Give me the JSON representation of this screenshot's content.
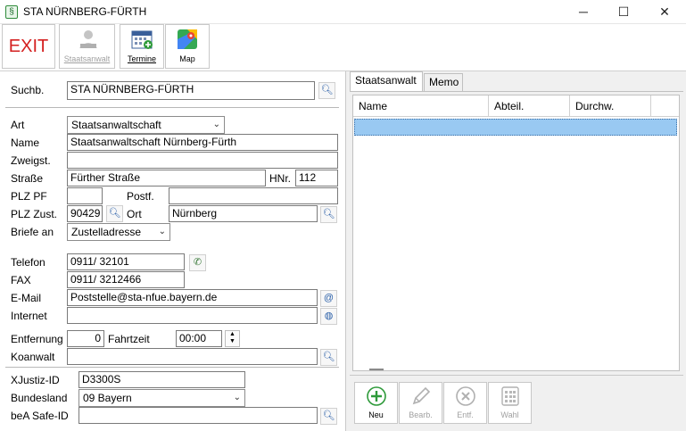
{
  "window": {
    "title": "STA NÜRNBERG-FÜRTH",
    "minimize": "─",
    "maximize": "☐",
    "close": "✕"
  },
  "toolbar": {
    "exit": "EXIT",
    "staatsanwalt": "Staatsanwalt",
    "termine": "Termine",
    "map": "Map"
  },
  "search": {
    "label": "Suchb.",
    "value": "STA NÜRNBERG-FÜRTH"
  },
  "form": {
    "art_label": "Art",
    "art_value": "Staatsanwaltschaft",
    "name_label": "Name",
    "name_value": "Staatsanwaltschaft Nürnberg-Fürth",
    "zweigst_label": "Zweigst.",
    "zweigst_value": "",
    "strasse_label": "Straße",
    "strasse_value": "Fürther Straße",
    "hnr_label": "HNr.",
    "hnr_value": "112",
    "plzpf_label": "PLZ PF",
    "plzpf_value": "",
    "postf_label": "Postf.",
    "postf_value": "",
    "plzzust_label": "PLZ Zust.",
    "plzzust_value": "90429",
    "ort_label": "Ort",
    "ort_value": "Nürnberg",
    "briefe_label": "Briefe an",
    "briefe_value": "Zustelladresse",
    "telefon_label": "Telefon",
    "telefon_value": "0911/ 32101",
    "fax_label": "FAX",
    "fax_value": "0911/ 3212466",
    "email_label": "E-Mail",
    "email_value": "Poststelle@sta-nfue.bayern.de",
    "internet_label": "Internet",
    "internet_value": "",
    "entfernung_label": "Entfernung",
    "entfernung_value": "0",
    "fahrzeit_label": "Fahrtzeit",
    "fahrzeit_value": "00:00",
    "koanwalt_label": "Koanwalt",
    "koanwalt_value": "",
    "xjustiz_label": "XJustiz-ID",
    "xjustiz_value": "D3300S",
    "bundesland_label": "Bundesland",
    "bundesland_value": "09 Bayern",
    "bea_label": "beA Safe-ID",
    "bea_value": ""
  },
  "tabs": {
    "staatsanwalt": "Staatsanwalt",
    "memo": "Memo"
  },
  "grid": {
    "columns": [
      "Name",
      "Abteil.",
      "Durchw."
    ]
  },
  "bottom": {
    "neu": "Neu",
    "bearb": "Bearb.",
    "entf": "Entf.",
    "wahl": "Wahl"
  }
}
